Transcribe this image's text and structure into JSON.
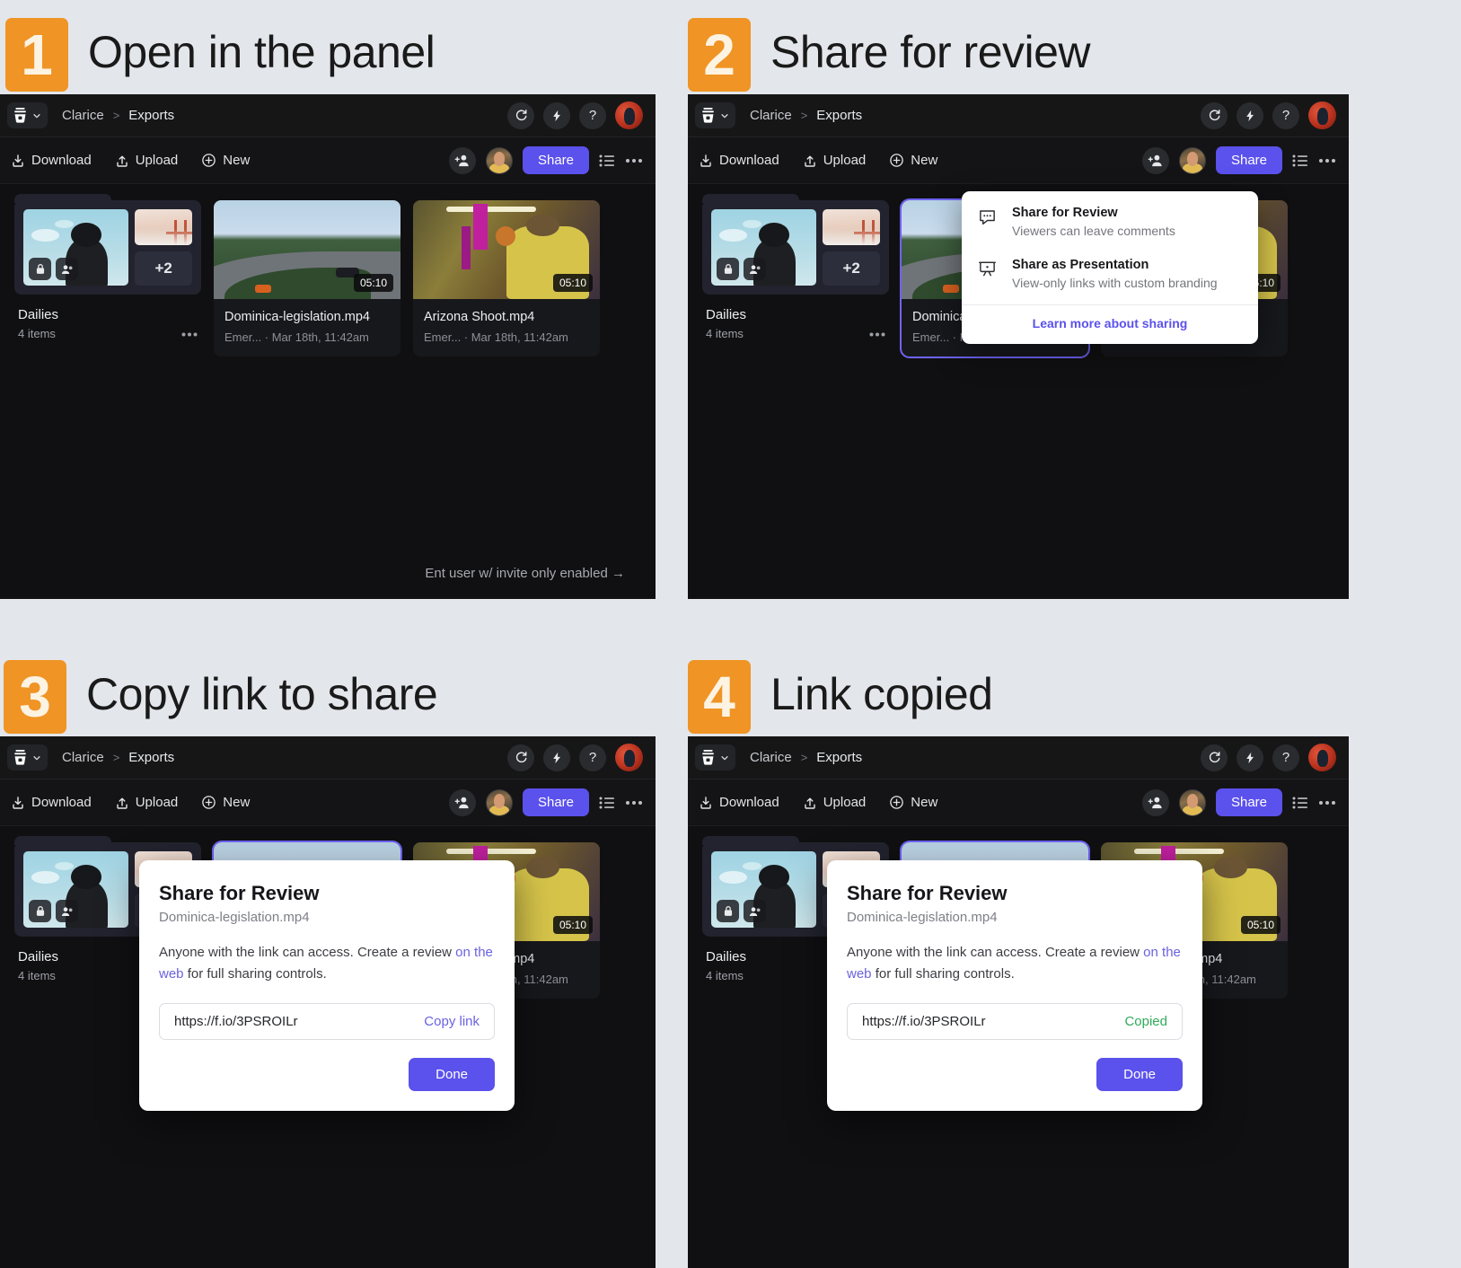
{
  "background_color": "#e3e6eb",
  "accent_orange": "#ef9425",
  "accent_purple": "#5b51ec",
  "success_green": "#2faa5c",
  "steps": [
    {
      "number": "1",
      "title": "Open in the panel"
    },
    {
      "number": "2",
      "title": "Share for review"
    },
    {
      "number": "3",
      "title": "Copy link to share"
    },
    {
      "number": "4",
      "title": "Link copied"
    }
  ],
  "app": {
    "topbar": {
      "logo_icon": "frameio-logo-icon",
      "chevron_icon": "chevron-down-icon",
      "breadcrumb": {
        "root": "Clarice",
        "separator": ">",
        "current": "Exports"
      },
      "icons": [
        {
          "name": "refresh-icon",
          "glyph": "↻"
        },
        {
          "name": "lightning-icon",
          "glyph": "⚡"
        },
        {
          "name": "help-icon",
          "glyph": "?"
        }
      ],
      "avatar_name": "user-avatar"
    },
    "actionbar": {
      "download_label": "Download",
      "upload_label": "Upload",
      "new_label": "New",
      "add_people_icon": "add-person-icon",
      "collaborator_avatar": "collaborator-avatar",
      "share_label": "Share",
      "list_view_icon": "list-view-icon",
      "more_icon": "more-options-icon"
    },
    "items": [
      {
        "kind": "folder",
        "name": "Dailies",
        "subtitle": "4 items",
        "overflow_count": "+2",
        "badges": [
          "lock-icon",
          "shared-people-icon"
        ],
        "more_icon": "more-options-icon"
      },
      {
        "kind": "file",
        "name": "Dominica-legislation.mp4",
        "subtitle": "Emer... · Mar 18th, 11:42am",
        "duration": "05:10"
      },
      {
        "kind": "file",
        "name": "Arizona Shoot.mp4",
        "subtitle": "Emer... · Mar 18th, 11:42am",
        "duration": "05:10"
      }
    ],
    "hint": "Ent user w/ invite only enabled →"
  },
  "share_menu": {
    "items": [
      {
        "icon": "comment-bubble-icon",
        "title": "Share for Review",
        "subtitle": "Viewers can leave comments"
      },
      {
        "icon": "presentation-icon",
        "title": "Share as Presentation",
        "subtitle": "View-only links with custom branding"
      }
    ],
    "footer_link": "Learn more about sharing"
  },
  "share_dialog": {
    "title": "Share for Review",
    "file_name": "Dominica-legislation.mp4",
    "body_before_link": "Anyone with the link can access. Create a review ",
    "body_link": "on the web",
    "body_after_link": " for full sharing controls.",
    "url": "https://f.io/3PSROILr",
    "copy_label": "Copy link",
    "copied_label": "Copied",
    "done_label": "Done"
  }
}
